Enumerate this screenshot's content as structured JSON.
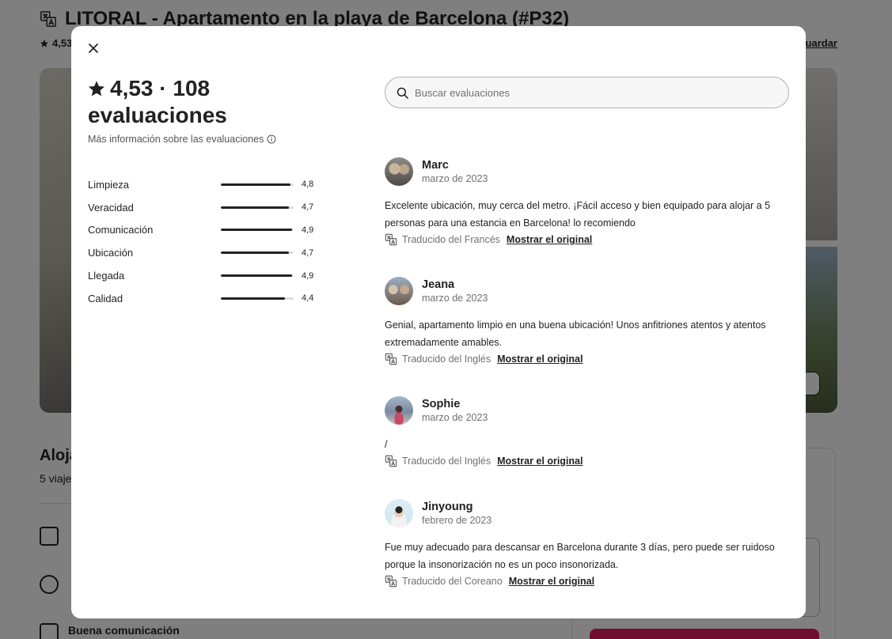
{
  "background": {
    "title": "LITORAL - Apartamento en la playa de Barcelona (#P32)",
    "rating_short": "4,53",
    "save_label": "Guardar",
    "section_title": "Aloja",
    "section_sub": "5 viaje",
    "feature_connection": "Buena comunicación"
  },
  "modal": {
    "summary": {
      "rating": "4,53",
      "separator": "·",
      "count": "108",
      "count_label": "evaluaciones",
      "more_info": "Más información sobre las evaluaciones"
    },
    "categories": [
      {
        "label": "Limpieza",
        "value": "4,8",
        "score": 4.8
      },
      {
        "label": "Veracidad",
        "value": "4,7",
        "score": 4.7
      },
      {
        "label": "Comunicación",
        "value": "4,9",
        "score": 4.9
      },
      {
        "label": "Ubicación",
        "value": "4,7",
        "score": 4.7
      },
      {
        "label": "Llegada",
        "value": "4,9",
        "score": 4.9
      },
      {
        "label": "Calidad",
        "value": "4,4",
        "score": 4.4
      }
    ],
    "search": {
      "placeholder": "Buscar evaluaciones"
    },
    "show_original_label": "Mostrar el original",
    "reviews": [
      {
        "name": "Marc",
        "date": "marzo de 2023",
        "text": "Excelente ubicación, muy cerca del metro. ¡Fácil acceso y bien equipado para alojar a 5 personas para una estancia en Barcelona! lo recomiendo",
        "translated": "Traducido del Francés"
      },
      {
        "name": "Jeana",
        "date": "marzo de 2023",
        "text": "Genial, apartamento limpio en una buena ubicación! Unos anfitriones atentos y atentos extremadamente amables.",
        "translated": "Traducido del Inglés"
      },
      {
        "name": "Sophie",
        "date": "marzo de 2023",
        "text": "/",
        "translated": "Traducido del Inglés"
      },
      {
        "name": "Jinyoung",
        "date": "febrero de 2023",
        "text": "Fue muy adecuado para descansar en Barcelona durante 3 días, pero puede ser ruidoso porque la insonorización no es un poco insonorizada.",
        "translated": "Traducido del Coreano"
      }
    ]
  }
}
